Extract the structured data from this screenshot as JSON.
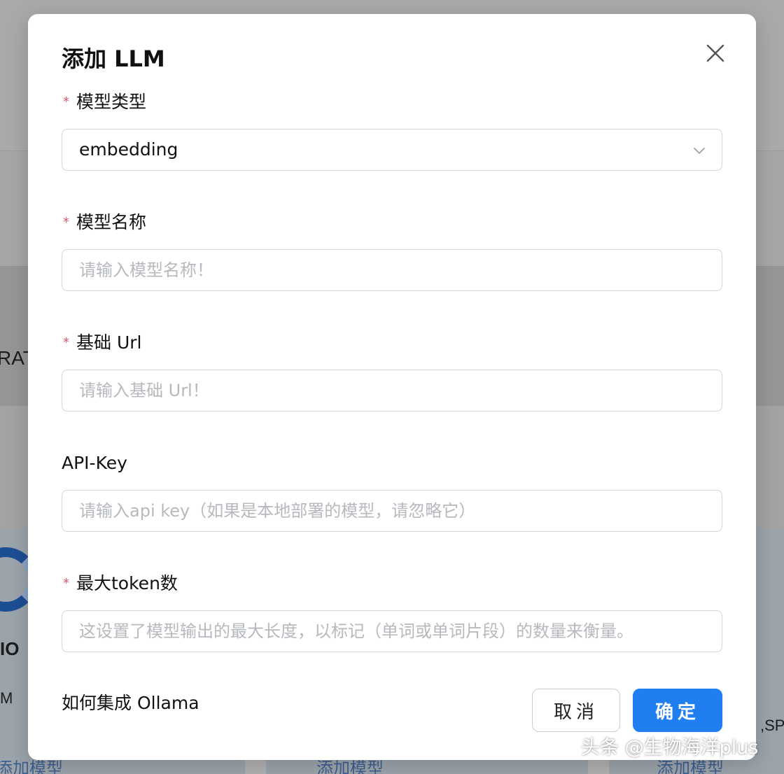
{
  "colors": {
    "primary": "#1f7ef0",
    "required": "#e05a6b",
    "border": "#cfd6de",
    "placeholder": "#b6b9bd"
  },
  "background": {
    "fragments": [
      "RAT",
      "IO",
      "M",
      ",SPI"
    ],
    "add_model_links": [
      "添加模型",
      "添加模型",
      "添加模型"
    ]
  },
  "dialog": {
    "title": "添加 LLM",
    "close_icon": "close-icon",
    "fields": {
      "model_type": {
        "label": "模型类型",
        "required_mark": "*",
        "value": "embedding",
        "icon": "chevron-down-icon"
      },
      "model_name": {
        "label": "模型名称",
        "required_mark": "*",
        "placeholder": "请输入模型名称！"
      },
      "base_url": {
        "label": "基础 Url",
        "required_mark": "*",
        "placeholder": "请输入基础 Url！"
      },
      "api_key": {
        "label": "API-Key",
        "placeholder": "请输入api key（如果是本地部署的模型，请忽略它）"
      },
      "max_tokens": {
        "label": "最大token数",
        "required_mark": "*",
        "placeholder": "这设置了模型输出的最大长度，以标记（单词或单词片段）的数量来衡量。"
      }
    },
    "footer": {
      "help_link": "如何集成 Ollama",
      "cancel_label": "取消",
      "ok_label": "确定"
    }
  },
  "watermark": "头条 @生物海洋plus"
}
